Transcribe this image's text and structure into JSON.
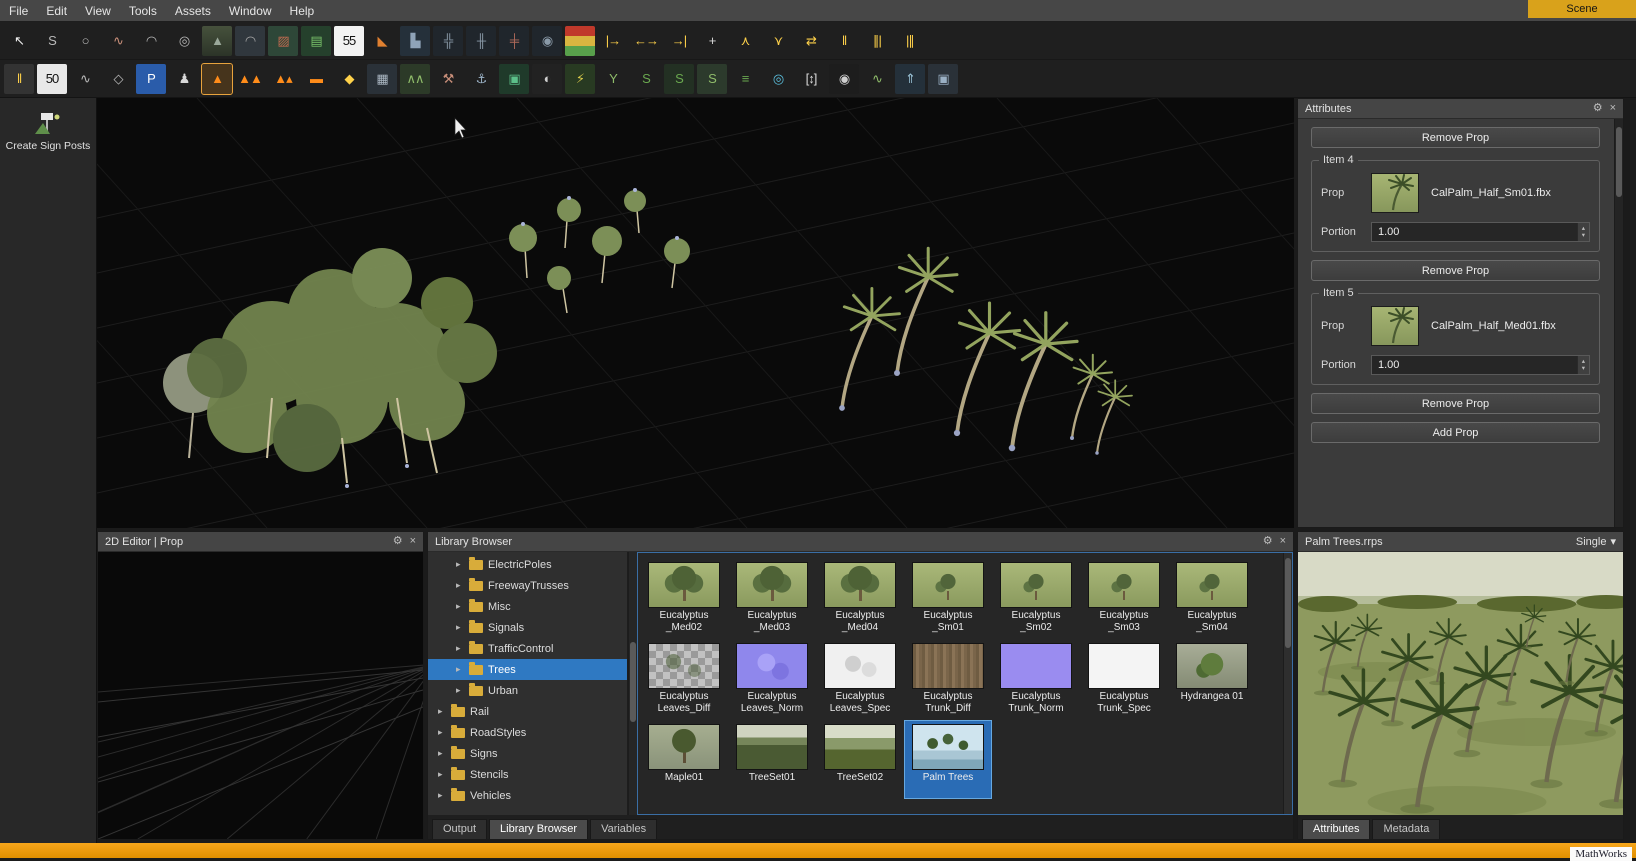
{
  "icons": {
    "gear": "⚙",
    "close": "×",
    "expand": "▸",
    "dropdown": "▾",
    "up": "▴",
    "down": "▾"
  },
  "menu": {
    "items": [
      {
        "name": "menu-file",
        "label": "File"
      },
      {
        "name": "menu-edit",
        "label": "Edit"
      },
      {
        "name": "menu-view",
        "label": "View"
      },
      {
        "name": "menu-tools",
        "label": "Tools"
      },
      {
        "name": "menu-assets",
        "label": "Assets"
      },
      {
        "name": "menu-window",
        "label": "Window"
      },
      {
        "name": "menu-help",
        "label": "Help"
      }
    ],
    "scene_tab": "Scene"
  },
  "toolbar_row1": [
    {
      "name": "select-tool-icon",
      "glyph": "↖",
      "fg": "#f0f0f0"
    },
    {
      "name": "curve-s-tool-icon",
      "glyph": "S",
      "fg": "#b9b9b9"
    },
    {
      "name": "circle-road-tool-icon",
      "glyph": "○",
      "fg": "#b9b9b9"
    },
    {
      "name": "spline-road-tool-icon",
      "glyph": "∿",
      "fg": "#c98f7a"
    },
    {
      "name": "arc-road-tool-icon",
      "glyph": "◠",
      "fg": "#b9b9b9"
    },
    {
      "name": "spiral-road-tool-icon",
      "glyph": "◎",
      "fg": "#b9b9b9"
    },
    {
      "name": "highway-road-tool-icon",
      "glyph": "▲",
      "fg": "#9aa89a",
      "bg": "linear-gradient(180deg,#46513c,#2c3428)"
    },
    {
      "name": "bridge-tool-icon",
      "glyph": "◠",
      "fg": "#a8a8a8",
      "bg": "#30373d"
    },
    {
      "name": "road-surface-tool-icon",
      "glyph": "▨",
      "fg": "#c06a4f",
      "bg": "#2e4738"
    },
    {
      "name": "crosswalk-surface-tool-icon",
      "glyph": "▤",
      "fg": "#79c26a",
      "bg": "#25402c"
    },
    {
      "name": "speed-limit-sign-icon",
      "glyph": "55",
      "fg": "#111111",
      "bg": "#f2f2f2"
    },
    {
      "name": "ramp-corner-tool-icon",
      "glyph": "◣",
      "fg": "#e08030"
    },
    {
      "name": "building-blocks-tool-icon",
      "glyph": "▙",
      "fg": "#8fa3b8",
      "bg": "#25303a"
    },
    {
      "name": "intersection-tool-icon",
      "glyph": "╬",
      "fg": "#8a9aa8",
      "bg": "#20262c"
    },
    {
      "name": "intersection-marking-tool-icon",
      "glyph": "╫",
      "fg": "#8a9aa8",
      "bg": "#20262c"
    },
    {
      "name": "intersection-paint-tool-icon",
      "glyph": "╪",
      "fg": "#b06a5a",
      "bg": "#20262c"
    },
    {
      "name": "roundabout-tool-icon",
      "glyph": "◉",
      "fg": "#8a9aa8",
      "bg": "#20262c"
    },
    {
      "name": "traffic-signal-tool-icon",
      "glyph": "",
      "fg": "#ffffff",
      "bg": "linear-gradient(180deg,#c0392b 0 33%,#d9b540 33% 66%,#58a04b 66% 100%)"
    },
    {
      "name": "lane-add-tool-icon",
      "glyph": "|→",
      "fg": "#ffd24a"
    },
    {
      "name": "lane-width-tool-icon",
      "glyph": "←→",
      "fg": "#ffd24a"
    },
    {
      "name": "lane-end-tool-icon",
      "glyph": "→|",
      "fg": "#ffd24a"
    },
    {
      "name": "lane-handle-tool-icon",
      "glyph": "+",
      "fg": "#d8d8d8"
    },
    {
      "name": "lane-split-tool-icon",
      "glyph": "⋏",
      "fg": "#ffd24a"
    },
    {
      "name": "lane-merge-tool-icon",
      "glyph": "⋎",
      "fg": "#ffd24a"
    },
    {
      "name": "lane-swap-tool-icon",
      "glyph": "⇄",
      "fg": "#ffd24a"
    },
    {
      "name": "lane-boundary-tool-icon",
      "glyph": "‖",
      "fg": "#ffd24a"
    },
    {
      "name": "lane-marking-double-tool-icon",
      "glyph": "∥|",
      "fg": "#ffd24a"
    },
    {
      "name": "lane-marking-triple-tool-icon",
      "glyph": "|∥",
      "fg": "#ffd24a"
    }
  ],
  "toolbar_row2": [
    {
      "name": "road-style-tool-icon",
      "glyph": "‖",
      "fg": "#ffd24a",
      "bg": "#333333"
    },
    {
      "name": "signpost-50-tool-icon",
      "glyph": "50",
      "fg": "#111111",
      "bg": "#e8e8e8"
    },
    {
      "name": "marking-curve-tool-icon",
      "glyph": "∿",
      "fg": "#b9b9b9"
    },
    {
      "name": "polygon-marking-tool-icon",
      "glyph": "◇",
      "fg": "#b9b9b9"
    },
    {
      "name": "parking-tool-icon",
      "glyph": "P",
      "fg": "#ffffff",
      "bg": "#2a5caa"
    },
    {
      "name": "crosswalk-pedestrian-tool-icon",
      "glyph": "♟",
      "fg": "#d8d8d8"
    },
    {
      "name": "traffic-cone-tool-icon",
      "glyph": "▲",
      "fg": "#ff8c1a",
      "selected": true
    },
    {
      "name": "cone-row-tool-icon",
      "glyph": "▲▲",
      "fg": "#ff8c1a"
    },
    {
      "name": "cone-cluster-tool-icon",
      "glyph": "▲▴",
      "fg": "#ff8c1a"
    },
    {
      "name": "barricade-tool-icon",
      "glyph": "▬",
      "fg": "#ff8c1a"
    },
    {
      "name": "warning-sign-tool-icon",
      "glyph": "◆",
      "fg": "#ffd24a"
    },
    {
      "name": "building-tool-icon",
      "glyph": "▦",
      "fg": "#aab6c2",
      "bg": "#2a3138"
    },
    {
      "name": "terrain-tool-icon",
      "glyph": "∧∧",
      "fg": "#8fbc6a",
      "bg": "#2c3a28"
    },
    {
      "name": "repair-tools-icon",
      "glyph": "⚒",
      "fg": "#c98f7a"
    },
    {
      "name": "anchor-tool-icon",
      "glyph": "⚓",
      "fg": "#9ab0c4"
    },
    {
      "name": "region-tool-icon",
      "glyph": "▣",
      "fg": "#5cc08a",
      "bg": "#1f3a2a"
    },
    {
      "name": "lighting-tool-icon",
      "glyph": "◐",
      "fg": "#cfcfcf",
      "bg": "#222222"
    },
    {
      "name": "vegetation-zap-tool-icon",
      "glyph": "⚡",
      "fg": "#d9c94a",
      "bg": "#283a22"
    },
    {
      "name": "branch-split-tool-icon",
      "glyph": "Y",
      "fg": "#8fbc6a"
    },
    {
      "name": "surface-layer-tool-icon",
      "glyph": "S",
      "fg": "#6aa84f"
    },
    {
      "name": "surface-stack-tool-icon",
      "glyph": "S",
      "fg": "#6aa84f",
      "bg": "#233023"
    },
    {
      "name": "surface-flatten-tool-icon",
      "glyph": "S",
      "fg": "#8fbc6a",
      "bg": "#2c3a2c"
    },
    {
      "name": "elevation-layers-tool-icon",
      "glyph": "≡",
      "fg": "#6aa84f"
    },
    {
      "name": "location-pin-tool-icon",
      "glyph": "◎",
      "fg": "#5bc0de"
    },
    {
      "name": "measure-tool-icon",
      "glyph": "[↕]",
      "fg": "#d8d8d8"
    },
    {
      "name": "camera-tool-icon",
      "glyph": "◉",
      "fg": "#cfcfcf",
      "bg": "#1d1d1d"
    },
    {
      "name": "road-visibility-tool-icon",
      "glyph": "∿",
      "fg": "#8fbc6a"
    },
    {
      "name": "scene-export-tool-icon",
      "glyph": "⇑",
      "fg": "#9bc4d8",
      "bg": "#24303a"
    },
    {
      "name": "duplicate-tool-icon",
      "glyph": "▣",
      "fg": "#9ab0c4",
      "bg": "#2a3138"
    }
  ],
  "left_tool": {
    "label": "Create Sign Posts"
  },
  "attributes_panel": {
    "title": "Attributes",
    "top_remove_label": "Remove Prop",
    "items": [
      {
        "group": "Item 4",
        "prop_label": "Prop",
        "file": "CalPalm_Half_Sm01.fbx",
        "portion_label": "Portion",
        "portion": "1.00",
        "remove_label": "Remove Prop"
      },
      {
        "group": "Item 5",
        "prop_label": "Prop",
        "file": "CalPalm_Half_Med01.fbx",
        "portion_label": "Portion",
        "portion": "1.00",
        "remove_label": "Remove Prop"
      }
    ],
    "add_prop_label": "Add Prop"
  },
  "editor2d": {
    "title": "2D Editor | Prop"
  },
  "library": {
    "title": "Library Browser",
    "tree": [
      {
        "name": "tree-item-electricpoles",
        "label": "ElectricPoles",
        "depth": 1
      },
      {
        "name": "tree-item-freewaytrusses",
        "label": "FreewayTrusses",
        "depth": 1
      },
      {
        "name": "tree-item-misc",
        "label": "Misc",
        "depth": 1
      },
      {
        "name": "tree-item-signals",
        "label": "Signals",
        "depth": 1
      },
      {
        "name": "tree-item-trafficcontrol",
        "label": "TrafficControl",
        "depth": 1
      },
      {
        "name": "tree-item-trees",
        "label": "Trees",
        "depth": 1,
        "selected": true
      },
      {
        "name": "tree-item-urban",
        "label": "Urban",
        "depth": 1
      },
      {
        "name": "tree-item-rail",
        "label": "Rail",
        "depth": 0
      },
      {
        "name": "tree-item-roadstyles",
        "label": "RoadStyles",
        "depth": 0
      },
      {
        "name": "tree-item-signs",
        "label": "Signs",
        "depth": 0
      },
      {
        "name": "tree-item-stencils",
        "label": "Stencils",
        "depth": 0
      },
      {
        "name": "tree-item-vehicles",
        "label": "Vehicles",
        "depth": 0
      }
    ],
    "assets": [
      {
        "name": "asset-eucalyptus-med02",
        "label": "Eucalyptus _Med02",
        "thumb": "tree-med"
      },
      {
        "name": "asset-eucalyptus-med03",
        "label": "Eucalyptus _Med03",
        "thumb": "tree-med"
      },
      {
        "name": "asset-eucalyptus-med04",
        "label": "Eucalyptus _Med04",
        "thumb": "tree-med"
      },
      {
        "name": "asset-eucalyptus-sm01",
        "label": "Eucalyptus _Sm01",
        "thumb": "tree-sm"
      },
      {
        "name": "asset-eucalyptus-sm02",
        "label": "Eucalyptus _Sm02",
        "thumb": "tree-sm"
      },
      {
        "name": "asset-eucalyptus-sm03",
        "label": "Eucalyptus _Sm03",
        "thumb": "tree-sm"
      },
      {
        "name": "asset-eucalyptus-sm04",
        "label": "Eucalyptus _Sm04",
        "thumb": "tree-sm"
      },
      {
        "name": "asset-eucalyptus-leaves-diff",
        "label": "Eucalyptus Leaves_Diff",
        "thumb": "leaves-diff"
      },
      {
        "name": "asset-eucalyptus-leaves-norm",
        "label": "Eucalyptus Leaves_Norm",
        "thumb": "leaves-norm"
      },
      {
        "name": "asset-eucalyptus-leaves-spec",
        "label": "Eucalyptus Leaves_Spec",
        "thumb": "leaves-spec"
      },
      {
        "name": "asset-eucalyptus-trunk-diff",
        "label": "Eucalyptus Trunk_Diff",
        "thumb": "trunk-diff"
      },
      {
        "name": "asset-eucalyptus-trunk-norm",
        "label": "Eucalyptus Trunk_Norm",
        "thumb": "trunk-norm"
      },
      {
        "name": "asset-eucalyptus-trunk-spec",
        "label": "Eucalyptus Trunk_Spec",
        "thumb": "trunk-spec"
      },
      {
        "name": "asset-hydrangea01",
        "label": "Hydrangea 01",
        "thumb": "hydrangea"
      },
      {
        "name": "asset-maple01",
        "label": "Maple01",
        "thumb": "maple"
      },
      {
        "name": "asset-treeset01",
        "label": "TreeSet01",
        "thumb": "forest"
      },
      {
        "name": "asset-treeset02",
        "label": "TreeSet02",
        "thumb": "forest2"
      },
      {
        "name": "asset-palm-trees",
        "label": "Palm Trees",
        "thumb": "palms",
        "selected": true
      }
    ],
    "tabs": [
      {
        "name": "tab-output",
        "label": "Output"
      },
      {
        "name": "tab-library-browser",
        "label": "Library Browser",
        "active": true
      },
      {
        "name": "tab-variables",
        "label": "Variables"
      }
    ]
  },
  "preview": {
    "title": "Palm Trees.rrps",
    "mode": "Single",
    "tabs": [
      {
        "name": "tab-attributes",
        "label": "Attributes",
        "active": true
      },
      {
        "name": "tab-metadata",
        "label": "Metadata"
      }
    ]
  },
  "statusbar": {
    "brand": "MathWorks"
  }
}
